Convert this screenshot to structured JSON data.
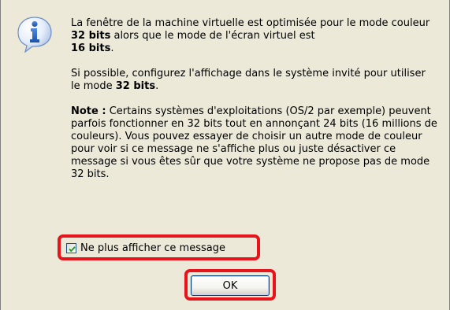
{
  "message": {
    "p1_a": "La fenêtre de la machine virtuelle est optimisée pour le mode couleur ",
    "p1_b": "32 bits",
    "p1_c": " alors que le mode de l'écran virtuel est ",
    "p1_d": "16 bits",
    "p1_e": ".",
    "p2_a": "Si possible, configurez l'affichage dans le système invité pour utiliser le mode ",
    "p2_b": "32 bits",
    "p2_c": ".",
    "p3_a": "Note :",
    "p3_b": " Certains systèmes d'exploitations (OS/2 par exemple) peuvent parfois fonctionner en 32 bits tout en annonçant 24 bits (16 millions de couleurs). Vous pouvez essayer de choisir un autre mode de couleur pour voir si ce message ne s'affiche plus ou juste désactiver ce message si vous êtes sûr que votre système ne propose pas de mode 32 bits."
  },
  "checkbox": {
    "label": "Ne plus afficher ce message",
    "checked": true
  },
  "ok_button": {
    "label": "OK"
  },
  "icon": "info-icon",
  "colors": {
    "background": "#ece9d8",
    "highlight": "#e8141c",
    "icon_blue": "#2f6fd0"
  }
}
